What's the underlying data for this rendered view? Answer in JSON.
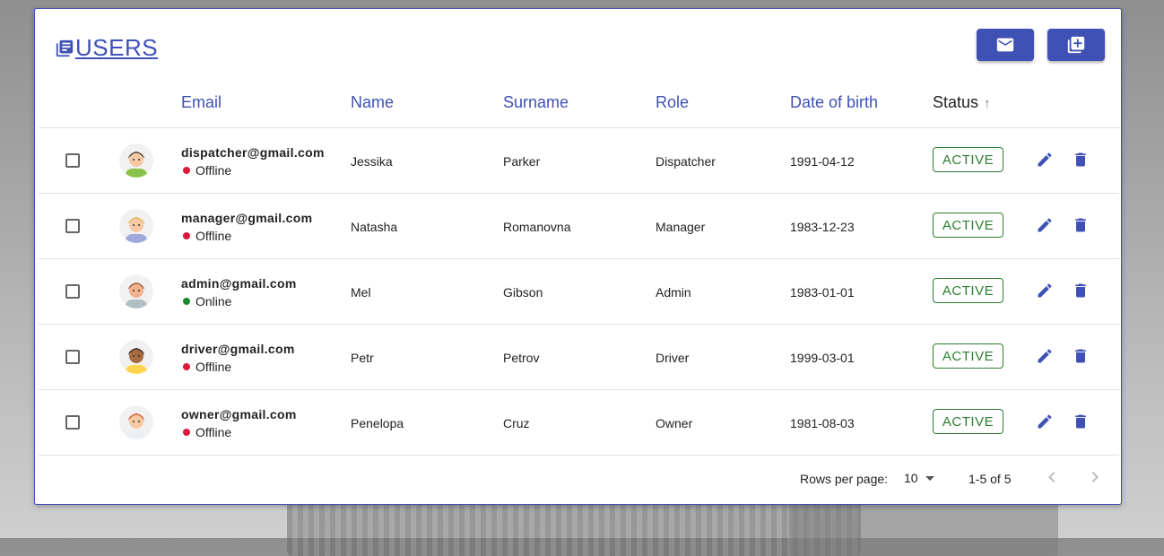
{
  "header": {
    "title": "USERS",
    "title_icon": "library-books-icon",
    "buttons": [
      {
        "name": "mail-button",
        "icon": "mail-icon"
      },
      {
        "name": "add-user-button",
        "icon": "library-add-icon"
      }
    ]
  },
  "table": {
    "columns": [
      {
        "key": "email",
        "label": "Email"
      },
      {
        "key": "name",
        "label": "Name"
      },
      {
        "key": "surname",
        "label": "Surname"
      },
      {
        "key": "role",
        "label": "Role"
      },
      {
        "key": "dob",
        "label": "Date of birth"
      },
      {
        "key": "status",
        "label": "Status",
        "sorted": "asc",
        "sort_icon": "arrow-up-icon"
      }
    ],
    "rows": [
      {
        "email": "dispatcher@gmail.com",
        "presence": "Offline",
        "presence_color": "#d81b3c",
        "name": "Jessika",
        "surname": "Parker",
        "role": "Dispatcher",
        "dob": "1991-04-12",
        "status": "ACTIVE",
        "avatar": "woman-braid-avatar"
      },
      {
        "email": "manager@gmail.com",
        "presence": "Offline",
        "presence_color": "#d81b3c",
        "name": "Natasha",
        "surname": "Romanovna",
        "role": "Manager",
        "dob": "1983-12-23",
        "status": "ACTIVE",
        "avatar": "woman-blonde-avatar"
      },
      {
        "email": "admin@gmail.com",
        "presence": "Online",
        "presence_color": "#1b8a2e",
        "name": "Mel",
        "surname": "Gibson",
        "role": "Admin",
        "dob": "1983-01-01",
        "status": "ACTIVE",
        "avatar": "man-beard-avatar"
      },
      {
        "email": "driver@gmail.com",
        "presence": "Offline",
        "presence_color": "#d81b3c",
        "name": "Petr",
        "surname": "Petrov",
        "role": "Driver",
        "dob": "1999-03-01",
        "status": "ACTIVE",
        "avatar": "man-dark-avatar"
      },
      {
        "email": "owner@gmail.com",
        "presence": "Offline",
        "presence_color": "#d81b3c",
        "name": "Penelopa",
        "surname": "Cruz",
        "role": "Owner",
        "dob": "1981-08-03",
        "status": "ACTIVE",
        "avatar": "man-redhair-avatar"
      }
    ]
  },
  "pagination": {
    "rows_per_page_label": "Rows per page:",
    "rows_per_page": "10",
    "range": "1-5 of 5"
  },
  "colors": {
    "primary": "#3f51b5",
    "status_active": "#2e7d32"
  }
}
